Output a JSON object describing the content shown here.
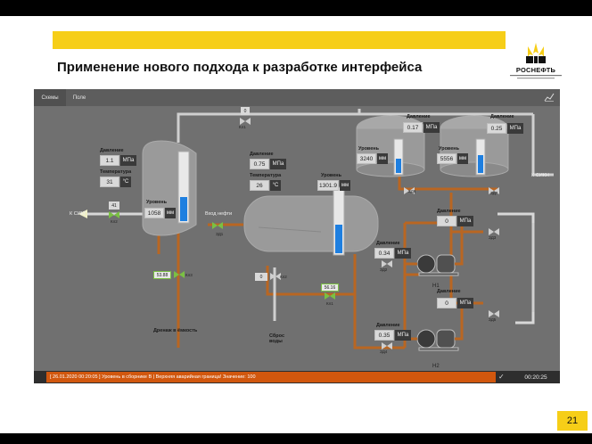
{
  "slide": {
    "title": "Применение нового подхода к разработке интерфейса",
    "logo_text": "РОСНЕФТЬ",
    "page_number": "21"
  },
  "tabs": [
    "Схемы",
    "Поле"
  ],
  "tank_left": {
    "pressure_label": "Давление",
    "pressure_value": "1.1",
    "pressure_unit": "МПа",
    "temp_label": "Температура",
    "temp_value": "31",
    "temp_unit": "°С",
    "level_label": "Уровень",
    "level_value": "1058",
    "level_unit": "мм",
    "level_fraction": 0.35
  },
  "valve_kv1": {
    "value": "0",
    "tag": "Кл1"
  },
  "valve_kv2": {
    "value": "41",
    "tag": "Кл2"
  },
  "valve_kv3": {
    "value": "53.88",
    "tag": "Кл3"
  },
  "to_siki": "К СИКГ",
  "inlet_label": "Вход нефти",
  "zd1": "ЗД1",
  "separator": {
    "pressure_label": "Давление",
    "pressure_value": "0.75",
    "pressure_unit": "МПа",
    "temp_label": "Температура",
    "temp_value": "26",
    "temp_unit": "°С",
    "level_label": "Уровень",
    "level_value": "1301.9",
    "level_unit": "мм",
    "level_fraction": 0.45
  },
  "valve_kv2b": {
    "value": "0",
    "tag": "Кл2"
  },
  "valve_kv1b": {
    "value": "56.16",
    "tag": "Кл1"
  },
  "drain_label": "Дренаж в ёмкость",
  "water_label": "Сброс воды",
  "tank_rv1": {
    "pressure_label": "Давление",
    "pressure_value": "0.17",
    "pressure_unit": "МПа",
    "level_label": "Уровень",
    "level_value": "3240",
    "level_unit": "мм",
    "level_fraction": 0.45
  },
  "tank_rv2": {
    "pressure_label": "Давление",
    "pressure_value": "0.25",
    "pressure_unit": "МПа",
    "level_label": "Уровень",
    "level_value": "5556",
    "level_unit": "мм",
    "level_fraction": 0.55
  },
  "zd6": "ЗД6",
  "zd7": "ЗД7",
  "to_sikn": "К СИКН",
  "header_pressure": {
    "label": "Давление",
    "value": "0",
    "unit": "МПа",
    "tag": "ЗД3"
  },
  "pump_h1": {
    "label": "Давление",
    "value": "0.34",
    "unit": "МПа",
    "valve": "ЗД2",
    "name": "Н1"
  },
  "pump_h2_out": {
    "label": "Давление",
    "value": "0",
    "unit": "МПа",
    "tag": "ЗД5"
  },
  "pump_h2": {
    "label": "Давление",
    "value": "0.35",
    "unit": "МПа",
    "valve": "ЗД4",
    "name": "Н2"
  },
  "status": {
    "alarm": "[ 26.01.2020  00:20:05 ]  Уровень в сборнике В | Верхняя аварийная граница! Значение: 100",
    "time": "00:20:25"
  },
  "colors": {
    "accent": "#f6ce18",
    "alarm": "#d1570e",
    "level": "#1e7fe0",
    "pipe_oil": "#b96622",
    "pipe_gas": "#cfcfcf"
  }
}
